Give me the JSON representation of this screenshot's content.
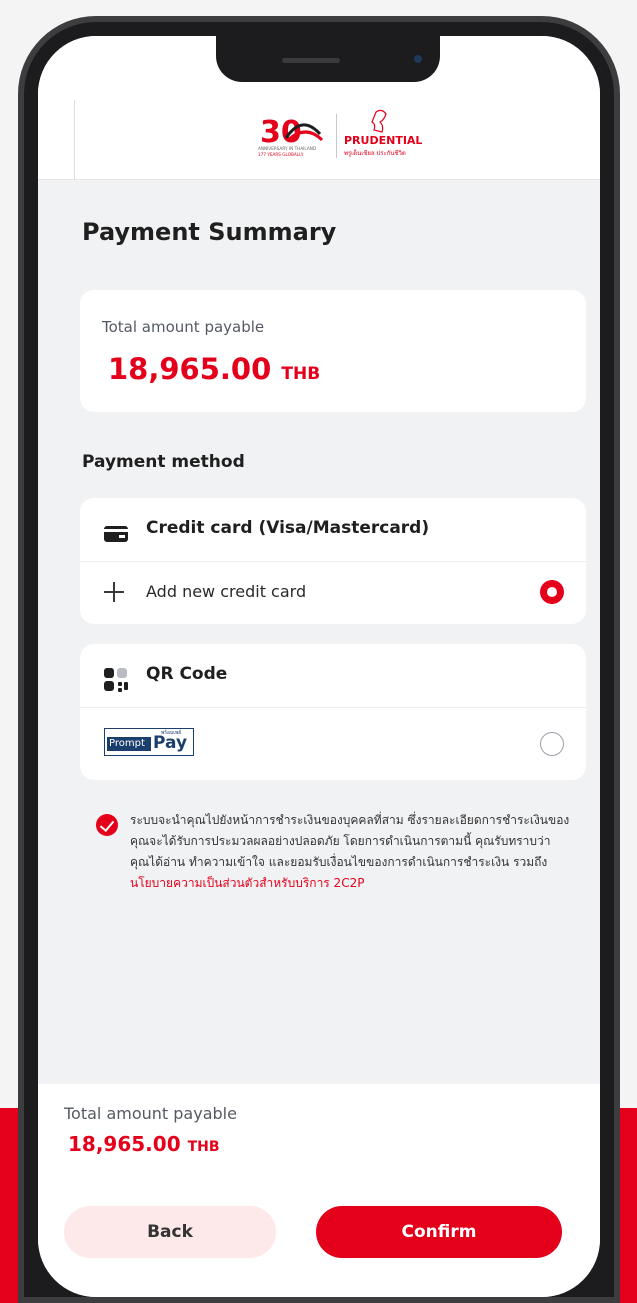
{
  "brand": {
    "logo_number": "30",
    "anniversary_line1": "ANNIVERSARY IN THAILAND",
    "anniversary_line2": "177 YEARS GLOBALLY",
    "name": "PRUDENTIAL",
    "tagline": "พรูเด็นเชียล ประกันชีวิต",
    "accent_color": "#e4001b"
  },
  "page": {
    "title": "Payment Summary"
  },
  "total": {
    "label": "Total amount payable",
    "amount": "18,965.00",
    "currency": "THB"
  },
  "payment_method": {
    "section_title": "Payment method",
    "credit_card": {
      "title": "Credit card (Visa/Mastercard)",
      "icon": "credit-card-icon",
      "add_label": "Add new credit card",
      "selected": true
    },
    "qr": {
      "title": "QR Code",
      "icon": "qr-code-icon",
      "option_logo_prompt": "Prompt",
      "option_logo_pay": "Pay",
      "option_logo_small": "พร้อมเพย์",
      "selected": false
    }
  },
  "consent": {
    "checked": true,
    "text": "ระบบจะนำคุณไปยังหน้าการชำระเงินของบุคคลที่สาม ซึ่งรายละเอียดการชำระเงินของคุณจะได้รับการประมวลผลอย่างปลอดภัย โดยการดำเนินการตามนี้ คุณรับทราบว่า คุณได้อ่าน ทำความเข้าใจ และยอมรับเงื่อนไขของการดำเนินการชำระเงิน รวมถึง ",
    "link": "นโยบายความเป็นส่วนตัวสำหรับบริการ 2C2P"
  },
  "footer": {
    "label": "Total amount payable",
    "amount": "18,965.00",
    "currency": "THB",
    "back_label": "Back",
    "confirm_label": "Confirm"
  }
}
